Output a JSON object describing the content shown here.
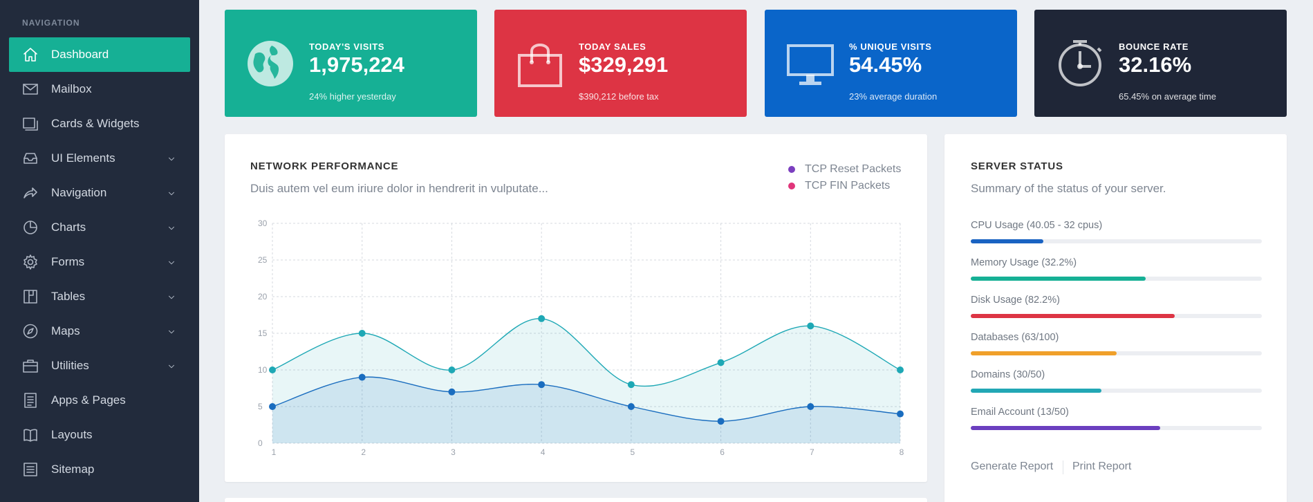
{
  "sidebar": {
    "heading": "NAVIGATION",
    "items": [
      {
        "label": "Dashboard",
        "icon": "home-icon",
        "active": true,
        "chevron": false
      },
      {
        "label": "Mailbox",
        "icon": "mail-icon",
        "active": false,
        "chevron": false
      },
      {
        "label": "Cards & Widgets",
        "icon": "cards-icon",
        "active": false,
        "chevron": false
      },
      {
        "label": "UI Elements",
        "icon": "inbox-icon",
        "active": false,
        "chevron": true
      },
      {
        "label": "Navigation",
        "icon": "share-icon",
        "active": false,
        "chevron": true
      },
      {
        "label": "Charts",
        "icon": "pie-chart-icon",
        "active": false,
        "chevron": true
      },
      {
        "label": "Forms",
        "icon": "gear-icon",
        "active": false,
        "chevron": true
      },
      {
        "label": "Tables",
        "icon": "table-icon",
        "active": false,
        "chevron": true
      },
      {
        "label": "Maps",
        "icon": "compass-icon",
        "active": false,
        "chevron": true
      },
      {
        "label": "Utilities",
        "icon": "briefcase-icon",
        "active": false,
        "chevron": true
      },
      {
        "label": "Apps & Pages",
        "icon": "document-icon",
        "active": false,
        "chevron": false
      },
      {
        "label": "Layouts",
        "icon": "book-icon",
        "active": false,
        "chevron": false
      },
      {
        "label": "Sitemap",
        "icon": "list-icon",
        "active": false,
        "chevron": false
      }
    ]
  },
  "stats": [
    {
      "label": "TODAY'S VISITS",
      "value": "1,975,224",
      "sub": "24% higher yesterday",
      "color": "#16b095",
      "icon": "globe-icon"
    },
    {
      "label": "TODAY SALES",
      "value": "$329,291",
      "sub": "$390,212 before tax",
      "color": "#dd3444",
      "icon": "shopping-bag-icon"
    },
    {
      "label": "% UNIQUE VISITS",
      "value": "54.45%",
      "sub": "23% average duration",
      "color": "#0a65c9",
      "icon": "monitor-icon"
    },
    {
      "label": "BOUNCE RATE",
      "value": "32.16%",
      "sub": "65.45% on average time",
      "color": "#1f2637",
      "icon": "clock-icon"
    }
  ],
  "network": {
    "title": "NETWORK PERFORMANCE",
    "subtitle": "Duis autem vel eum iriure dolor in hendrerit in vulputate..."
  },
  "chart_data": {
    "type": "area",
    "x": [
      1,
      2,
      3,
      4,
      5,
      6,
      7,
      8
    ],
    "series": [
      {
        "name": "TCP Reset Packets",
        "legend_color": "#7b3fbf",
        "line_color": "#1ea8b5",
        "values": [
          10,
          15,
          10,
          17,
          8,
          11,
          16,
          10
        ]
      },
      {
        "name": "TCP FIN Packets",
        "legend_color": "#e0357a",
        "line_color": "#1a6dbf",
        "values": [
          5,
          9,
          7,
          8,
          5,
          3,
          5,
          4
        ]
      }
    ],
    "yticks": [
      0,
      5,
      10,
      15,
      20,
      25,
      30
    ],
    "ylim": [
      0,
      30
    ],
    "xlim": [
      1,
      8
    ],
    "grid": true,
    "legend": "top-right"
  },
  "server": {
    "title": "SERVER STATUS",
    "subtitle": "Summary of the status of your server.",
    "bars": [
      {
        "label": "CPU Usage (40.05 - 32 cpus)",
        "pct": 25,
        "color": "#1a63c2"
      },
      {
        "label": "Memory Usage (32.2%)",
        "pct": 60,
        "color": "#16b095"
      },
      {
        "label": "Disk Usage (82.2%)",
        "pct": 70,
        "color": "#dd3444"
      },
      {
        "label": "Databases (63/100)",
        "pct": 50,
        "color": "#f0a02a"
      },
      {
        "label": "Domains (30/50)",
        "pct": 45,
        "color": "#22a7b5"
      },
      {
        "label": "Email Account (13/50)",
        "pct": 65,
        "color": "#6b3fbf"
      }
    ],
    "links": [
      "Generate Report",
      "Print Report"
    ]
  }
}
